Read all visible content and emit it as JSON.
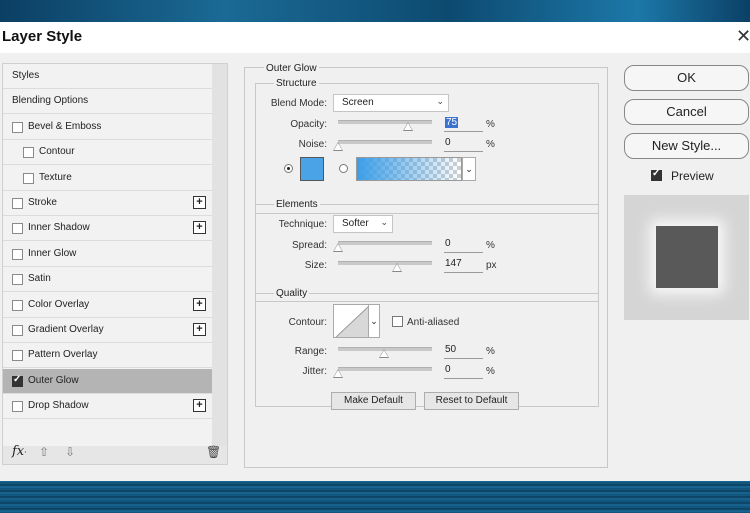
{
  "dialog": {
    "title": "Layer Style",
    "close_label": "✕"
  },
  "style_list": {
    "items": [
      {
        "label": "Styles",
        "has_checkbox": false,
        "checked": false,
        "has_plus": false,
        "indent": false,
        "selected": false
      },
      {
        "label": "Blending Options",
        "has_checkbox": false,
        "checked": false,
        "has_plus": false,
        "indent": false,
        "selected": false
      },
      {
        "label": "Bevel & Emboss",
        "has_checkbox": true,
        "checked": false,
        "has_plus": false,
        "indent": false,
        "selected": false
      },
      {
        "label": "Contour",
        "has_checkbox": true,
        "checked": false,
        "has_plus": false,
        "indent": true,
        "selected": false
      },
      {
        "label": "Texture",
        "has_checkbox": true,
        "checked": false,
        "has_plus": false,
        "indent": true,
        "selected": false
      },
      {
        "label": "Stroke",
        "has_checkbox": true,
        "checked": false,
        "has_plus": true,
        "indent": false,
        "selected": false
      },
      {
        "label": "Inner Shadow",
        "has_checkbox": true,
        "checked": false,
        "has_plus": true,
        "indent": false,
        "selected": false
      },
      {
        "label": "Inner Glow",
        "has_checkbox": true,
        "checked": false,
        "has_plus": false,
        "indent": false,
        "selected": false
      },
      {
        "label": "Satin",
        "has_checkbox": true,
        "checked": false,
        "has_plus": false,
        "indent": false,
        "selected": false
      },
      {
        "label": "Color Overlay",
        "has_checkbox": true,
        "checked": false,
        "has_plus": true,
        "indent": false,
        "selected": false
      },
      {
        "label": "Gradient Overlay",
        "has_checkbox": true,
        "checked": false,
        "has_plus": true,
        "indent": false,
        "selected": false
      },
      {
        "label": "Pattern Overlay",
        "has_checkbox": true,
        "checked": false,
        "has_plus": false,
        "indent": false,
        "selected": false
      },
      {
        "label": "Outer Glow",
        "has_checkbox": true,
        "checked": true,
        "has_plus": false,
        "indent": false,
        "selected": true
      },
      {
        "label": "Drop Shadow",
        "has_checkbox": true,
        "checked": false,
        "has_plus": true,
        "indent": false,
        "selected": false
      }
    ],
    "footer": {
      "fx_label": "fx",
      "fx_suffix": "·",
      "up_icon": "⇧",
      "down_icon": "⇩",
      "trash_icon": "🗑"
    }
  },
  "outer_glow": {
    "title": "Outer Glow",
    "structure": {
      "title": "Structure",
      "blend_mode_label": "Blend Mode:",
      "blend_mode_value": "Screen",
      "opacity_label": "Opacity:",
      "opacity_value": "75",
      "opacity_unit": "%",
      "noise_label": "Noise:",
      "noise_value": "0",
      "noise_unit": "%",
      "glow_color": "#4aa3e6"
    },
    "elements": {
      "title": "Elements",
      "technique_label": "Technique:",
      "technique_value": "Softer",
      "spread_label": "Spread:",
      "spread_value": "0",
      "spread_unit": "%",
      "size_label": "Size:",
      "size_value": "147",
      "size_unit": "px"
    },
    "quality": {
      "title": "Quality",
      "contour_label": "Contour:",
      "anti_aliased_label": "Anti-aliased",
      "anti_aliased_checked": false,
      "range_label": "Range:",
      "range_value": "50",
      "range_unit": "%",
      "jitter_label": "Jitter:",
      "jitter_value": "0",
      "jitter_unit": "%"
    },
    "make_default_label": "Make Default",
    "reset_default_label": "Reset to Default"
  },
  "buttons": {
    "ok": "OK",
    "cancel": "Cancel",
    "new_style": "New Style...",
    "preview_label": "Preview",
    "preview_checked": true
  },
  "preview": {
    "square_color": "#595959"
  },
  "icons": {
    "dropdown": "chevron-down-icon",
    "close": "close-icon",
    "add": "plus-icon",
    "delete": "trash-icon"
  }
}
